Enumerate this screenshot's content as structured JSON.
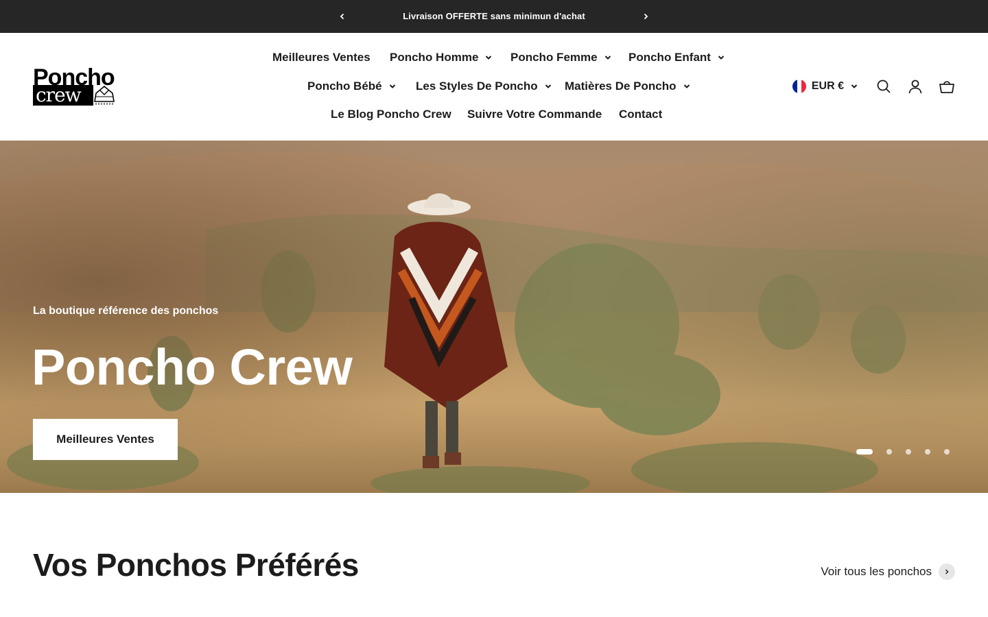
{
  "announcement": {
    "message": "Livraison OFFERTE sans minimun d'achat",
    "prev_icon": "chevron-left-icon",
    "next_icon": "chevron-right-icon"
  },
  "logo": {
    "line1": "Poncho",
    "line2": "crew"
  },
  "nav": {
    "items": [
      {
        "label": "Meilleures Ventes",
        "dropdown": false
      },
      {
        "label": "Poncho Homme",
        "dropdown": true
      },
      {
        "label": "Poncho Femme",
        "dropdown": true
      },
      {
        "label": "Poncho Enfant",
        "dropdown": true
      },
      {
        "label": "Poncho Bébé",
        "dropdown": true
      },
      {
        "label": "Les Styles De Poncho",
        "dropdown": true
      },
      {
        "label": "Matières De Poncho",
        "dropdown": true
      },
      {
        "label": "Le Blog Poncho Crew",
        "dropdown": false
      },
      {
        "label": "Suivre Votre Commande",
        "dropdown": false
      },
      {
        "label": "Contact",
        "dropdown": false
      }
    ]
  },
  "tools": {
    "currency": "EUR €",
    "flag_colors": [
      "#002395",
      "#ffffff",
      "#ed2939"
    ],
    "search_icon": "search-icon",
    "account_icon": "account-icon",
    "cart_icon": "cart-icon"
  },
  "hero": {
    "subtitle": "La boutique référence des ponchos",
    "title": "Poncho Crew",
    "button": "Meilleures Ventes",
    "slide_count": 5,
    "active_slide": 1
  },
  "favorites": {
    "title": "Vos Ponchos Préférés",
    "view_all": "Voir tous les ponchos"
  }
}
